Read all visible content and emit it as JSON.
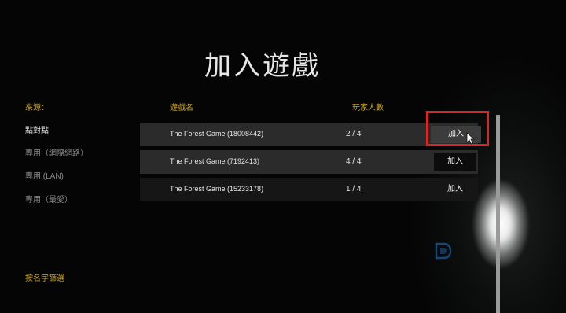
{
  "screen": {
    "title": "加入遊戲"
  },
  "sidebar": {
    "heading": "來源：",
    "items": [
      {
        "label": "點對點",
        "active": true
      },
      {
        "label": "專用（網際網路）",
        "active": false
      },
      {
        "label": "專用 (LAN)",
        "active": false
      },
      {
        "label": "專用（最愛）",
        "active": false
      }
    ],
    "bottom_label": "按名字篩選"
  },
  "table": {
    "headers": {
      "name": "遊戲名",
      "players": "玩家人數"
    },
    "join_label": "加入",
    "rows": [
      {
        "name": "The Forest Game (18008442)",
        "players": "2 / 4"
      },
      {
        "name": "The Forest Game (7192413)",
        "players": "4 / 4"
      },
      {
        "name": "The Forest Game (15233178)",
        "players": "1 / 4"
      }
    ]
  },
  "colors": {
    "accent_gold": "#c9a42a",
    "highlight_red": "#d9262a",
    "row_bg": "#2b2b2b"
  },
  "icons": {
    "cursor": "mouse-pointer-icon",
    "watermark": "watermark-logo-icon"
  }
}
